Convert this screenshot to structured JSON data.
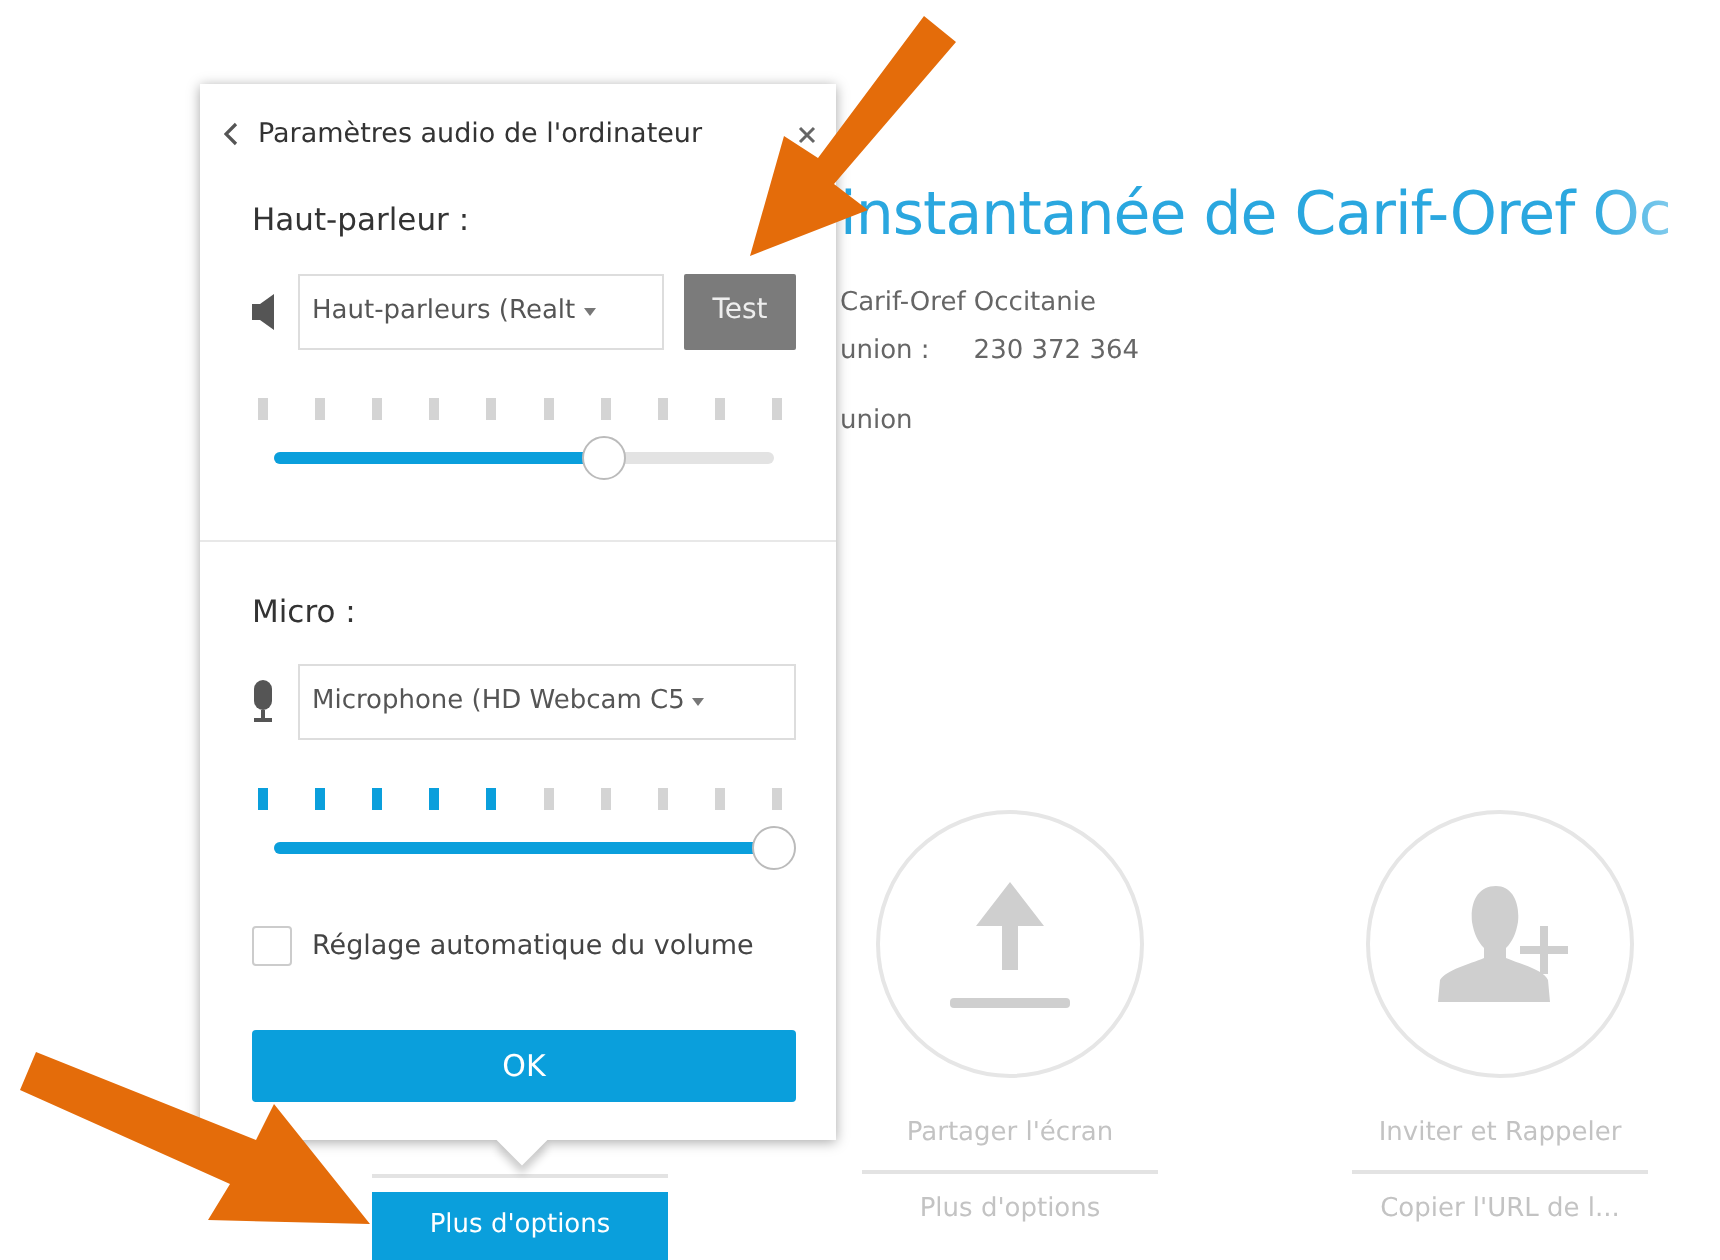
{
  "background": {
    "title": "instantanée de Carif-Oref Oc",
    "info": [
      {
        "label": "Carif-Oref Occitanie"
      },
      {
        "label": "union :",
        "value": "230 372 364"
      },
      {
        "label": "union"
      }
    ],
    "columns": [
      {
        "kind": "audio",
        "more": "Plus d'options",
        "highlighted": true
      },
      {
        "kind": "share",
        "label": "Partager l'écran",
        "more": "Plus d'options",
        "highlighted": false
      },
      {
        "kind": "invite",
        "label": "Inviter et Rappeler",
        "more": "Copier l'URL de l...",
        "highlighted": false
      }
    ]
  },
  "dialog": {
    "title": "Paramètres audio de l'ordinateur",
    "sections": [
      {
        "kind": "speaker",
        "heading": "Haut-parleur :",
        "device": "Haut-parleurs (Realt",
        "button": "Test",
        "meter": {
          "level": 0
        },
        "volume": {
          "level": 0.66
        }
      },
      {
        "kind": "micro",
        "heading": "Micro :",
        "device": "Microphone (HD Webcam C5",
        "meter": {
          "level": 0.5
        },
        "volume": {
          "level": 1
        }
      }
    ],
    "auto_volume": {
      "label": "Réglage automatique du volume",
      "checked": false
    },
    "ok": "OK"
  }
}
